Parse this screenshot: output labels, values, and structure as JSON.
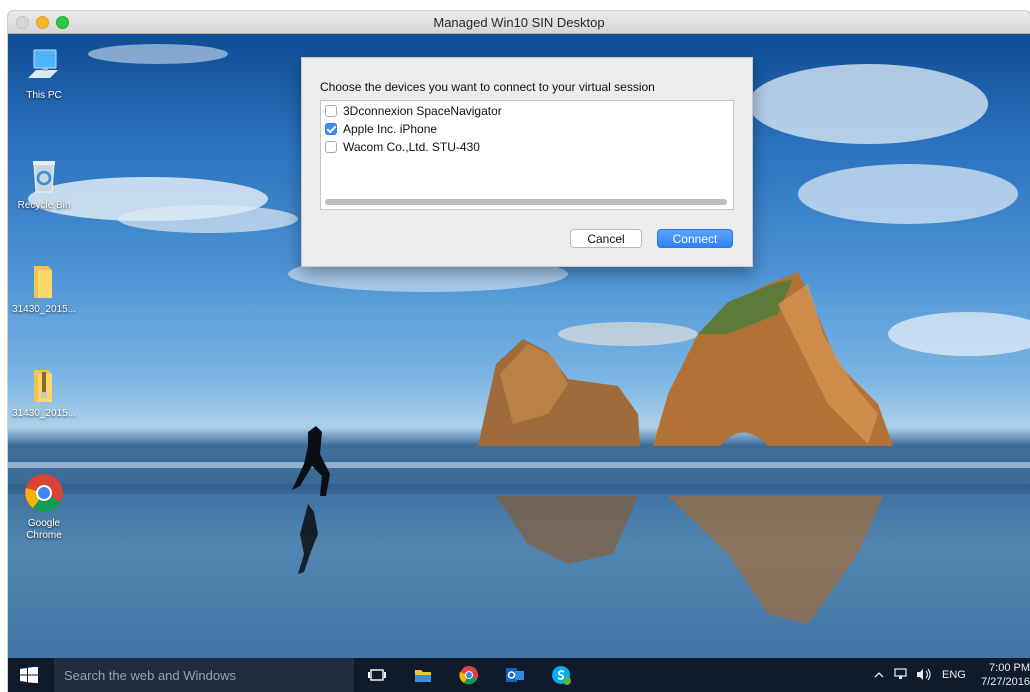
{
  "window": {
    "title": "Managed Win10 SIN Desktop"
  },
  "desktop_icons": [
    {
      "label": "This PC",
      "icon": "computer-icon"
    },
    {
      "label": "Recycle Bin",
      "icon": "recycle-bin-icon"
    },
    {
      "label": "31430_2015...",
      "icon": "folder-icon"
    },
    {
      "label": "31430_2015...",
      "icon": "zip-folder-icon"
    },
    {
      "label": "Google Chrome",
      "icon": "chrome-icon"
    }
  ],
  "dialog": {
    "prompt": "Choose the devices you want to connect to your virtual session",
    "devices": [
      {
        "label": "3Dconnexion SpaceNavigator",
        "checked": false
      },
      {
        "label": "Apple Inc. iPhone",
        "checked": true
      },
      {
        "label": "Wacom Co.,Ltd. STU-430",
        "checked": false
      }
    ],
    "cancel_label": "Cancel",
    "connect_label": "Connect",
    "accent_color": "#3d8cf6"
  },
  "taskbar": {
    "search_placeholder": "Search the web and Windows",
    "apps": [
      "task-view-icon",
      "file-explorer-icon",
      "chrome-icon",
      "outlook-icon",
      "skype-icon"
    ],
    "tray_language": "ENG",
    "clock_time": "7:00 PM",
    "clock_date": "7/27/2016"
  }
}
